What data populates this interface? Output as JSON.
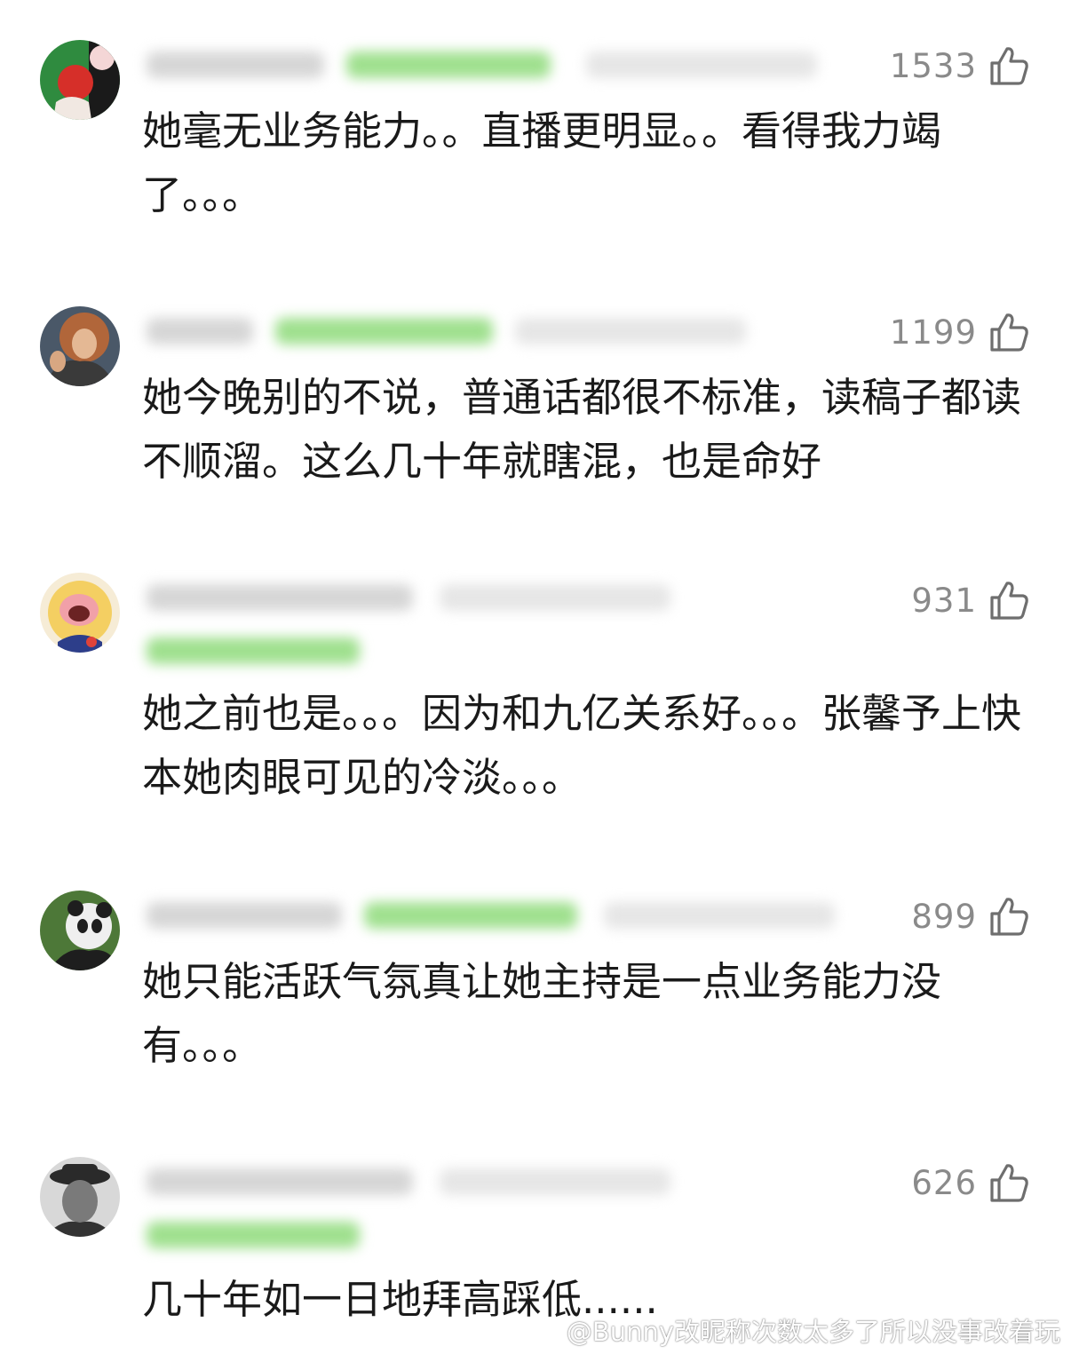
{
  "comments": [
    {
      "likes": "1533",
      "text": "她毫无业务能力。。直播更明显。。看得我力竭了。。。",
      "avatar": "apple-hand-avatar",
      "colors": {
        "bg": "#2d8a3d",
        "accent": "#d9322a"
      }
    },
    {
      "likes": "1199",
      "text": "她今晚别的不说，普通话都很不标准，读稿子都读不顺溜。这么几十年就瞎混，也是命好",
      "avatar": "curly-hair-person-avatar",
      "colors": {
        "bg": "#4c5a6a",
        "accent": "#b5683a"
      }
    },
    {
      "likes": "931",
      "text": "她之前也是。。。因为和九亿关系好。。。张馨予上快本她肉眼可见的冷淡。。。",
      "avatar": "cartoon-character-avatar",
      "colors": {
        "bg": "#f7d46a",
        "accent": "#e0433a"
      }
    },
    {
      "likes": "899",
      "text": "她只能活跃气氛真让她主持是一点业务能力没有。。。",
      "avatar": "panda-avatar",
      "colors": {
        "bg": "#4f7a39",
        "accent": "#f2f2f2"
      }
    },
    {
      "likes": "626",
      "text": "几十年如一日地拜高踩低......",
      "avatar": "dark-hat-person-avatar",
      "colors": {
        "bg": "#3a3a3a",
        "accent": "#9a9a9a"
      }
    }
  ],
  "watermark": "@Bunny改昵称次数太多了所以没事改着玩",
  "icons": {
    "like": "thumbs-up-icon",
    "weibo": "weibo-logo-icon"
  }
}
